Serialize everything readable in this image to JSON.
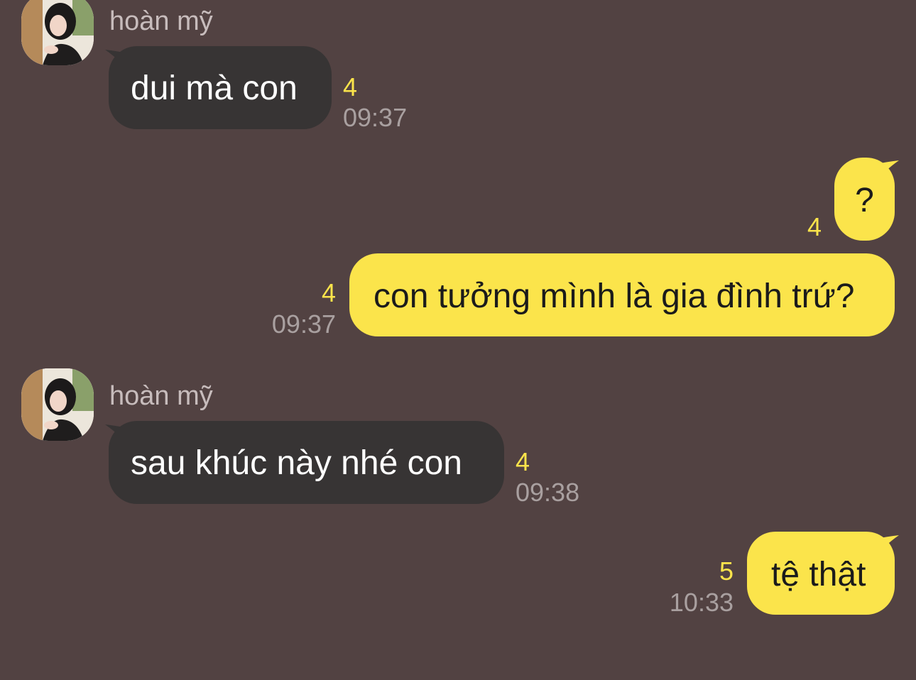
{
  "messages": [
    {
      "direction": "incoming",
      "sender": "hoàn mỹ",
      "text": "dui mà con",
      "unread": "4",
      "time": "09:37"
    },
    {
      "direction": "outgoing",
      "text": "?",
      "unread": "4",
      "time": ""
    },
    {
      "direction": "outgoing",
      "text": "con tưởng mình là gia đình trứ?",
      "unread": "4",
      "time": "09:37"
    },
    {
      "direction": "incoming",
      "sender": "hoàn mỹ",
      "text": "sau khúc này nhé con",
      "unread": "4",
      "time": "09:38"
    },
    {
      "direction": "outgoing",
      "text": "tệ thật",
      "unread": "5",
      "time": "10:33"
    }
  ],
  "colors": {
    "background": "#524242",
    "incoming_bubble": "#373434",
    "outgoing_bubble": "#fbe44b",
    "unread_count": "#fbe44b",
    "timestamp": "#a9a0a0",
    "sender_name": "#c7bcbc"
  }
}
